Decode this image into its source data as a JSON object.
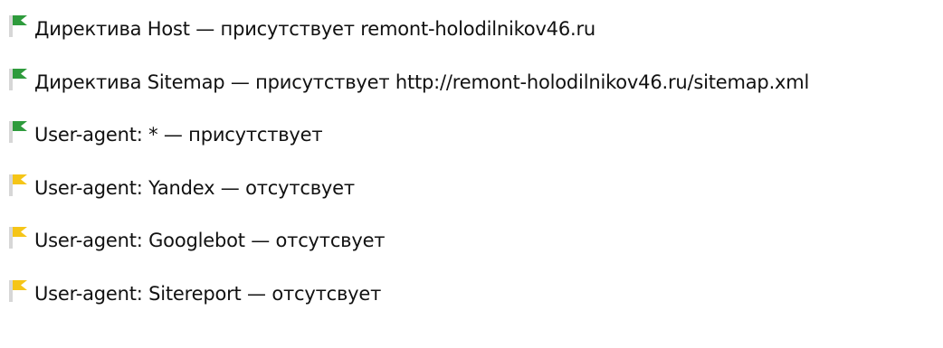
{
  "colors": {
    "pass_flag": "#2e9b3c",
    "warn_flag": "#f5c518",
    "flag_pole": "#d7d7d7",
    "text": "#111111"
  },
  "checks": [
    {
      "status": "pass",
      "icon": "green-flag-icon",
      "text": "Директива Host — присутствует remont-holodilnikov46.ru"
    },
    {
      "status": "pass",
      "icon": "green-flag-icon",
      "text": "Директива Sitemap — присутствует http://remont-holodilnikov46.ru/sitemap.xml"
    },
    {
      "status": "pass",
      "icon": "green-flag-icon",
      "text": "User-agent: * — присутствует"
    },
    {
      "status": "warn",
      "icon": "yellow-flag-icon",
      "text": "User-agent: Yandex — отсутсвует"
    },
    {
      "status": "warn",
      "icon": "yellow-flag-icon",
      "text": "User-agent: Googlebot — отсутсвует"
    },
    {
      "status": "warn",
      "icon": "yellow-flag-icon",
      "text": "User-agent: Sitereport — отсутсвует"
    }
  ]
}
